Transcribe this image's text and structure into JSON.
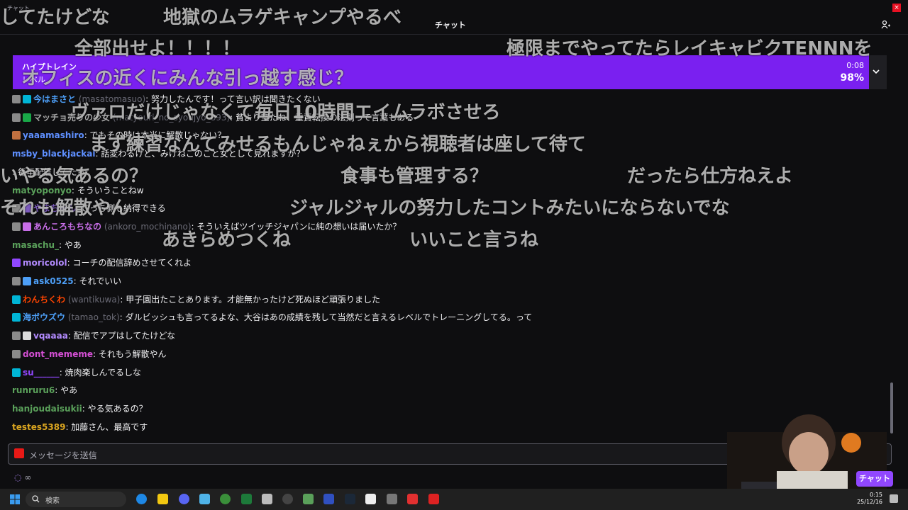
{
  "window": {
    "tiny_title": "チャット"
  },
  "header": {
    "title": "チャット"
  },
  "hype_train": {
    "label": "ハイプトレイン",
    "level": "レベル",
    "time": "0:08",
    "percent": "98%",
    "progress": 0.98,
    "color": "#7a20f0"
  },
  "messages": [
    {
      "badges": [
        "#8a8a8a",
        "#00b5d6"
      ],
      "user": "今はまさと",
      "alt": " (masatomasuo)",
      "color": "#4d9ff7",
      "text": "努力したんです！って言い訳は聞きたくない"
    },
    {
      "badges": [
        "#8a8a8a",
        "#19a848"
      ],
      "user": "マッチョ売りの少女",
      "alt": " (matyouri_no_syoujyo_893)",
      "color": "#a9a9a9",
      "text": "貧より室たね、重責転換の法則って言葉もある"
    },
    {
      "badges": [
        "#c07040"
      ],
      "user": "yaaamashiro",
      "alt": "",
      "color": "#5e8fff",
      "text": "でもその時は本当に解散じゃない？"
    },
    {
      "badges": [],
      "user": "msby_blackjackal",
      "alt": "",
      "color": "#5e8fff",
      "text": "話変わるけど、みけねこのこと女として見れますか？"
    },
    {
      "badges": [],
      "user": "",
      "alt": "",
      "color": "#ff3b3b",
      "text": "毎年配信してたら"
    },
    {
      "badges": [],
      "user": "matyoponyo",
      "alt": "",
      "color": "#5aa05a",
      "text": "そういうことねw"
    },
    {
      "badges": [
        "#8a8a8a",
        "#7d5bbe"
      ],
      "user": "やまちゃん",
      "alt": "",
      "color": "#7d5bbe",
      "text": "こっち側も納得できる"
    },
    {
      "badges": [
        "#8a8a8a",
        "#c86ee8"
      ],
      "user": "あんころもちなの",
      "alt": " (ankoro_mochinano)",
      "color": "#c86ee8",
      "text": "そういえばツイッチジャパンに純の想いは届いたか？"
    },
    {
      "badges": [],
      "user": "masachu_",
      "alt": "",
      "color": "#5aa05a",
      "text": "やあ"
    },
    {
      "badges": [
        "#9147ff"
      ],
      "user": "moricolol",
      "alt": "",
      "color": "#b38bff",
      "text": "コーチの配信辞めさせてくれよ"
    },
    {
      "badges": [
        "#8a8a8a",
        "#4d9ff7"
      ],
      "user": "ask0525",
      "alt": "",
      "color": "#4d9ff7",
      "text": "それでいい"
    },
    {
      "badges": [
        "#00b5d6"
      ],
      "user": "わんちくわ",
      "alt": " (wantikuwa)",
      "color": "#ff4500",
      "text": "甲子園出たことあります。才能無かったけど死ぬほど頑張りました"
    },
    {
      "badges": [
        "#00b5d6"
      ],
      "user": "海ボウズウ",
      "alt": " (tamao_tok)",
      "color": "#4d9ff7",
      "text": "ダルビッシュも言ってるよな、大谷はあの成績を残して当然だと言えるレベルでトレーニングしてる。って"
    },
    {
      "badges": [
        "#8a8a8a",
        "#dddddd"
      ],
      "user": "vqaaaa",
      "alt": "",
      "color": "#b38bff",
      "text": "配信でアプはしてたけどな"
    },
    {
      "badges": [
        "#8a8a8a"
      ],
      "user": "dont_mememe",
      "alt": "",
      "color": "#d34fd3",
      "text": "それもう解散やん"
    },
    {
      "badges": [
        "#00b5d6"
      ],
      "user": "su______",
      "alt": "",
      "color": "#9147ff",
      "text": "焼肉楽しんでるしな"
    },
    {
      "badges": [],
      "user": "runruru6",
      "alt": "",
      "color": "#5aa05a",
      "text": "やあ"
    },
    {
      "badges": [],
      "user": "hanjoudaisukii",
      "alt": "",
      "color": "#5aa05a",
      "text": "やる気あるの？"
    },
    {
      "badges": [],
      "user": "testes5389",
      "alt": "",
      "color": "#daa520",
      "text": "加藤さん、最高です"
    }
  ],
  "overlay_comments": [
    "してたけどな",
    "地獄のムラゲキャンプやるべ",
    "全部出せよ！！！！",
    "極限までやってたらレイキャビクTENNNを",
    "オフィスの近くにみんな引っ越す感じ？",
    "ヴァロだけじゃなくて毎日10時間エイムラボさせろ",
    "まず練習なんてみせるもんじゃねぇから視聴者は座して待て",
    "いやる気あるの？",
    "食事も管理する？",
    "だったら仕方ねえよ",
    "それも解散やん",
    "ジャルジャルの努力したコントみたいにならないでな",
    "あきらめつくね",
    "いいこと言うね"
  ],
  "input": {
    "placeholder": "メッセージを送信"
  },
  "footer": {
    "points": "∞",
    "chat_button": "チャット"
  },
  "taskbar": {
    "search_label": "検索",
    "time": "0:15",
    "date": "25/12/16"
  }
}
